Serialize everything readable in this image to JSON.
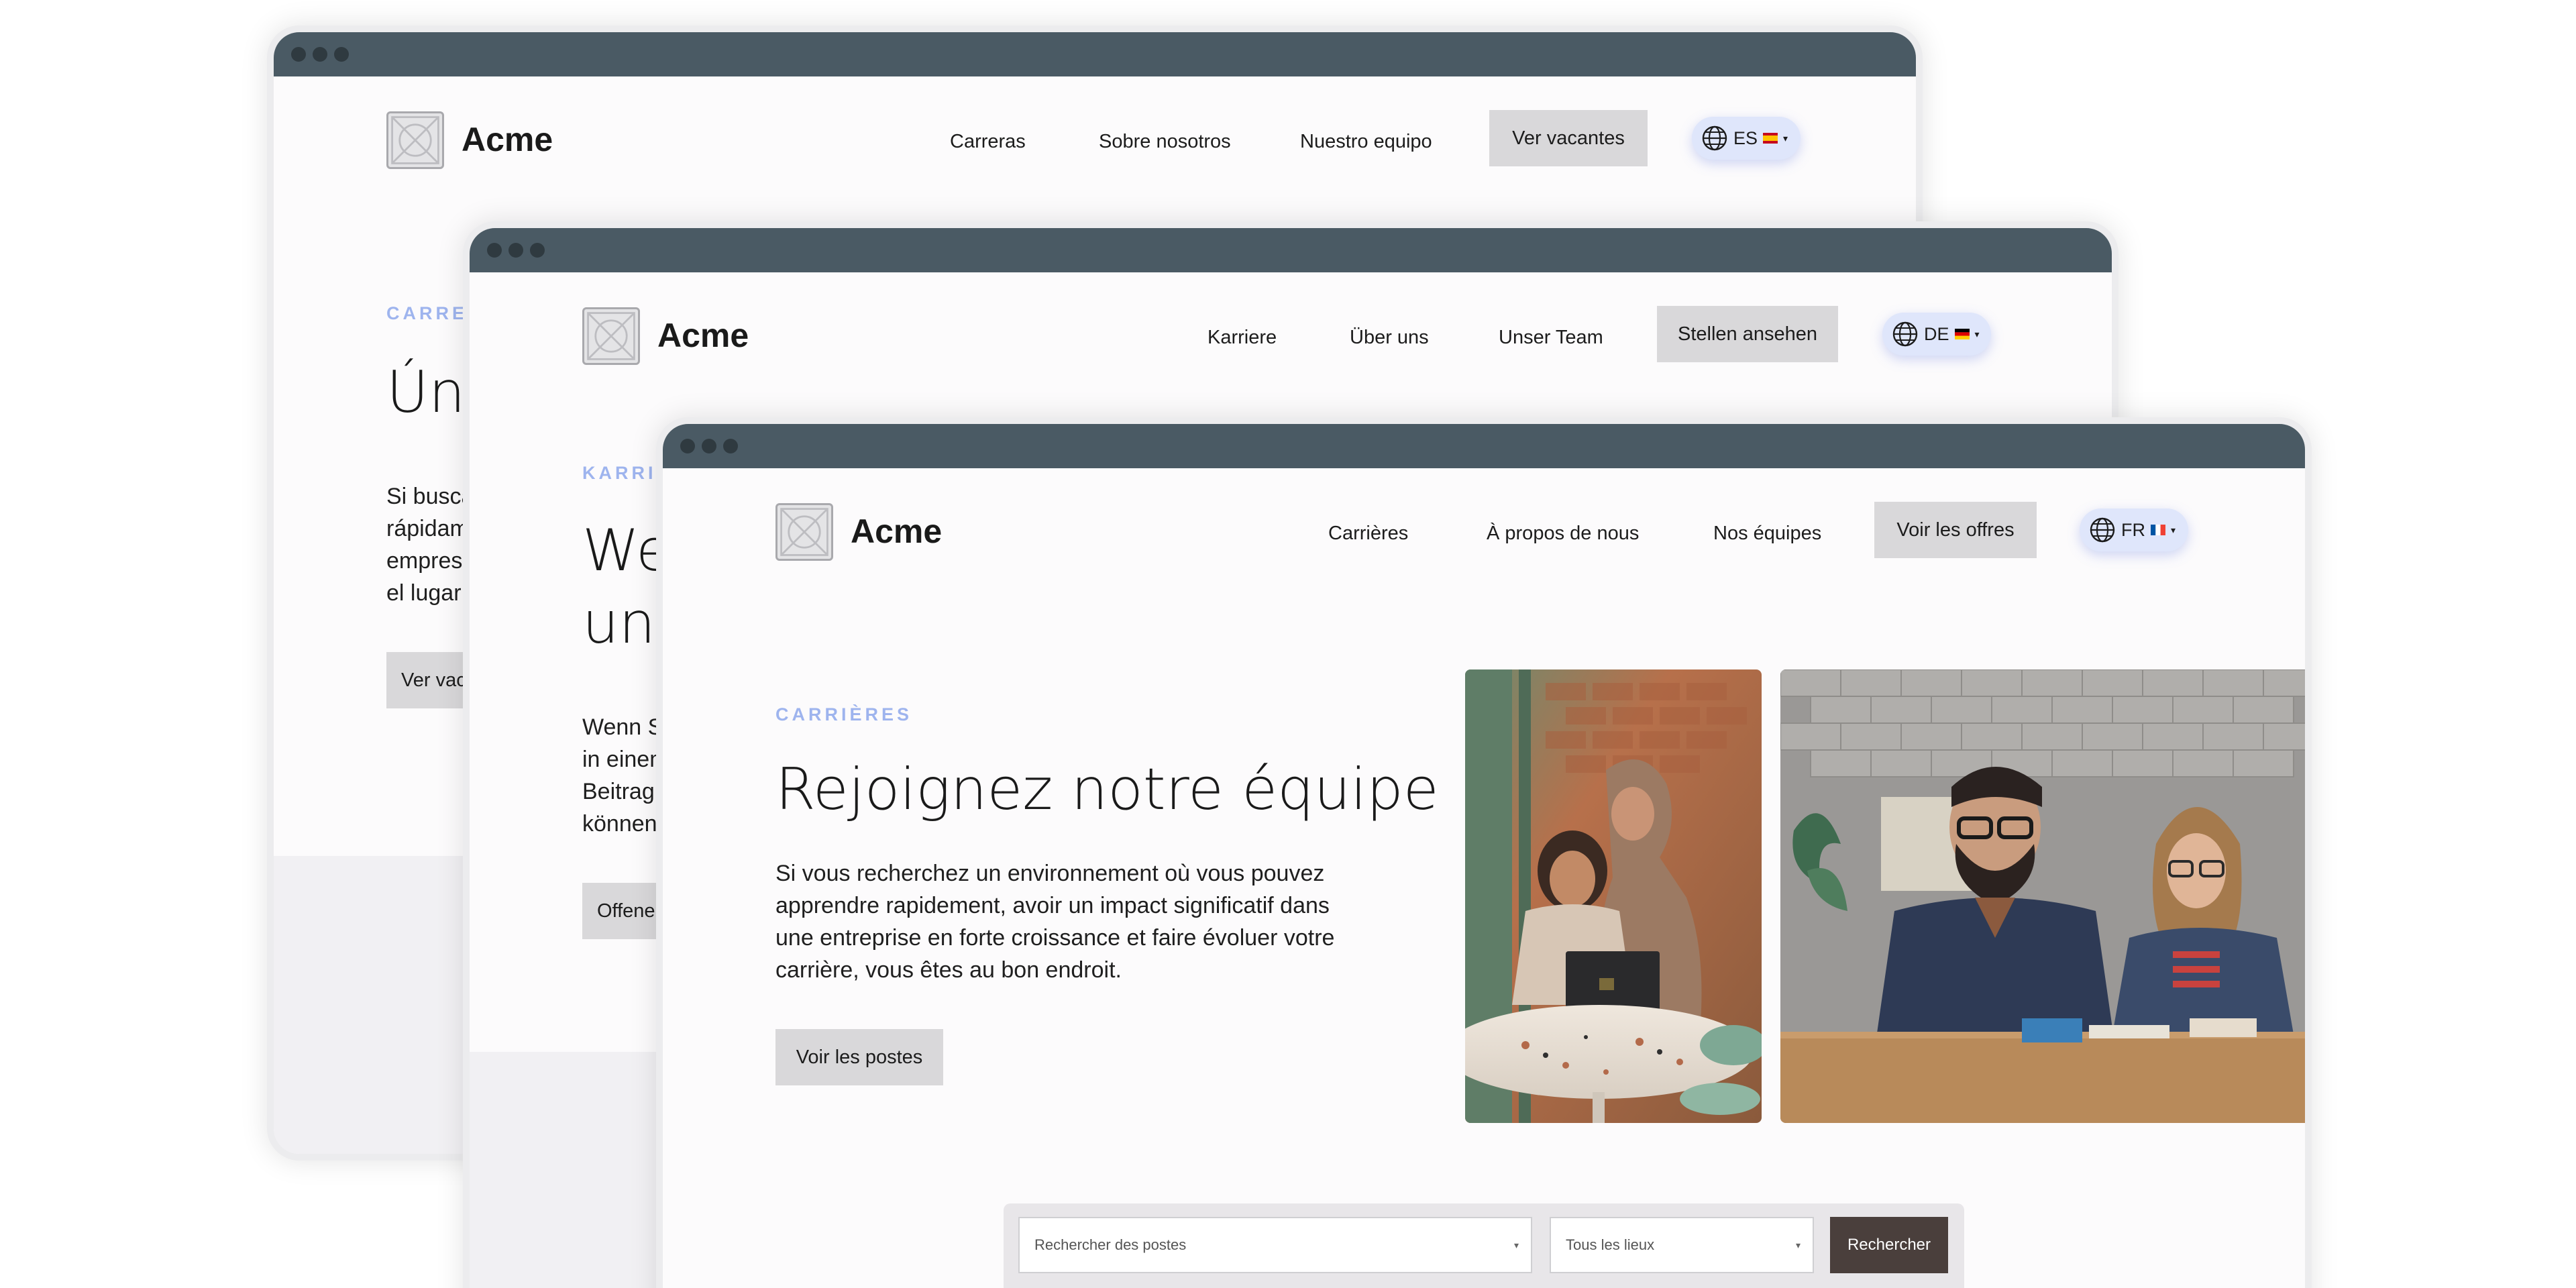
{
  "windows": {
    "es": {
      "brand": "Acme",
      "nav": [
        "Carreras",
        "Sobre nosotros",
        "Nuestro equipo"
      ],
      "cta": "Ver vacantes",
      "lang": "ES",
      "eyebrow": "CARRER",
      "title": "Úne",
      "body": [
        "Si busca",
        "rápidam",
        "empresa",
        "el lugar"
      ],
      "button": "Ver vaca"
    },
    "de": {
      "brand": "Acme",
      "nav": [
        "Karriere",
        "Über uns",
        "Unser Team"
      ],
      "cta": "Stellen ansehen",
      "lang": "DE",
      "eyebrow": "KARRIE",
      "title": [
        "We",
        "uns"
      ],
      "body": [
        "Wenn Si",
        "in einem",
        "Beitrag",
        "können,"
      ],
      "button": "Offene"
    },
    "fr": {
      "brand": "Acme",
      "nav": [
        "Carrières",
        "À propos de nous",
        "Nos équipes"
      ],
      "cta": "Voir les offres",
      "lang": "FR",
      "eyebrow": "CARRIÈRES",
      "title": "Rejoignez notre équipe",
      "body": "Si vous recherchez un environnement où vous pouvez apprendre rapidement, avoir un impact significatif dans une entreprise en forte croissance et faire évoluer votre carrière, vous êtes au bon endroit.",
      "button": "Voir les postes",
      "search": {
        "keyword_placeholder": "Rechercher des postes",
        "location_value": "Tous les lieux",
        "button": "Rechercher"
      }
    }
  },
  "icons": {
    "logo": "logo-placeholder-icon",
    "globe": "globe-icon",
    "caret": "chevron-down-icon"
  },
  "colors": {
    "titlebar": "#4a5a64",
    "accent_eyebrow": "#9eb4ee",
    "cta_bg": "#d9d8da",
    "lang_pill": "#dfe6fb",
    "search_button": "#4a3f3c"
  }
}
